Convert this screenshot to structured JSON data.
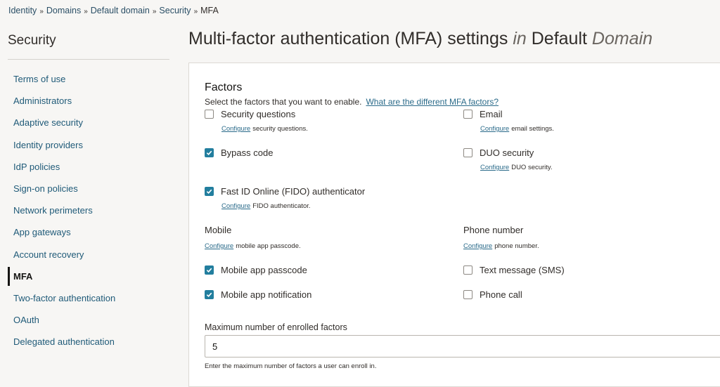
{
  "breadcrumb": {
    "items": [
      "Identity",
      "Domains",
      "Default domain",
      "Security"
    ],
    "current": "MFA"
  },
  "sidebar": {
    "title": "Security",
    "items": [
      {
        "label": "Terms of use"
      },
      {
        "label": "Administrators"
      },
      {
        "label": "Adaptive security"
      },
      {
        "label": "Identity providers"
      },
      {
        "label": "IdP policies"
      },
      {
        "label": "Sign-on policies"
      },
      {
        "label": "Network perimeters"
      },
      {
        "label": "App gateways"
      },
      {
        "label": "Account recovery"
      },
      {
        "label": "MFA",
        "active": true
      },
      {
        "label": "Two-factor authentication"
      },
      {
        "label": "OAuth"
      },
      {
        "label": "Delegated authentication"
      }
    ]
  },
  "page": {
    "title_main": "Multi-factor authentication (MFA) settings",
    "title_in": "in",
    "title_domain": "Default",
    "title_domain_suffix": "Domain"
  },
  "factors": {
    "title": "Factors",
    "description": "Select the factors that you want to enable.",
    "help_link": "What are the different MFA factors?",
    "configure_link": "Configure",
    "security_questions": {
      "label": "Security questions",
      "checked": false,
      "sub": "security questions."
    },
    "email": {
      "label": "Email",
      "checked": false,
      "sub": "email settings."
    },
    "bypass_code": {
      "label": "Bypass code",
      "checked": true
    },
    "duo": {
      "label": "DUO security",
      "checked": false,
      "sub": "DUO security."
    },
    "fido": {
      "label": "Fast ID Online (FIDO) authenticator",
      "checked": true,
      "sub": "FIDO authenticator."
    }
  },
  "mobile": {
    "title": "Mobile",
    "sub": "mobile app passcode.",
    "passcode": {
      "label": "Mobile app passcode",
      "checked": true
    },
    "notification": {
      "label": "Mobile app notification",
      "checked": true
    }
  },
  "phone": {
    "title": "Phone number",
    "sub": "phone number.",
    "sms": {
      "label": "Text message (SMS)",
      "checked": false
    },
    "call": {
      "label": "Phone call",
      "checked": false
    }
  },
  "max_factors": {
    "label": "Maximum number of enrolled factors",
    "value": "5",
    "help": "Enter the maximum number of factors a user can enroll in."
  },
  "colors": {
    "accent": "#227e9e",
    "link": "#2b6b8a",
    "text": "#312d2a"
  }
}
